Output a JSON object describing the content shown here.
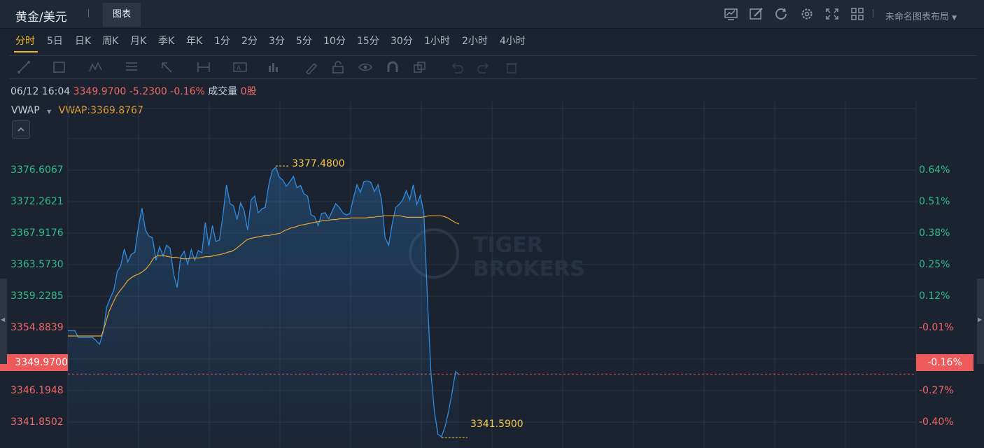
{
  "header": {
    "symbol": "黄金/美元",
    "chart_tab": "图表",
    "layout_label": "未命名图表布局"
  },
  "toolbar_icons": [
    "chart-icon",
    "edit-icon",
    "refresh-icon",
    "settings-icon",
    "fullscreen-icon",
    "layout-grid-icon"
  ],
  "periods": [
    "分时",
    "5日",
    "日K",
    "周K",
    "月K",
    "季K",
    "年K",
    "1分",
    "2分",
    "3分",
    "5分",
    "10分",
    "15分",
    "30分",
    "1小时",
    "2小时",
    "4小时"
  ],
  "active_period": "分时",
  "info": {
    "datetime": "06/12 16:04",
    "price": "3349.9700",
    "change": "-5.2300",
    "change_pct": "-0.16%",
    "volume_label": "成交量",
    "volume": "0股"
  },
  "indicator": {
    "name": "VWAP",
    "value": "VWAP:3369.8767"
  },
  "watermark": [
    "TIGER",
    "BROKERS"
  ],
  "colors": {
    "bg": "#1b2330",
    "line": "#2f8ce0",
    "vwap": "#e8a331",
    "up": "#2ebd85",
    "down": "#f06868",
    "extreme": "#f2c94c"
  },
  "chart_data": {
    "type": "line",
    "y_ticks_left": [
      "3376.6067",
      "3372.2621",
      "3367.9176",
      "3363.5730",
      "3359.2285",
      "3354.8839",
      "3346.1948",
      "3341.8502"
    ],
    "y_ticks_right": [
      "0.64%",
      "0.51%",
      "0.38%",
      "0.25%",
      "0.12%",
      "-0.01%",
      "-0.27%",
      "-0.40%"
    ],
    "current_price_label": "3349.9700",
    "current_pct_label": "-0.16%",
    "high_label": "3377.4800",
    "low_label": "3341.5900",
    "ylim": [
      3340.2,
      3386.0
    ],
    "high": 3377.48,
    "low": 3341.59,
    "current": 3349.97,
    "price_series": [
      3355.7,
      3355.7,
      3355.7,
      3354.8,
      3354.8,
      3354.8,
      3354.8,
      3354.8,
      3354.4,
      3353.9,
      3355.5,
      3358.8,
      3360.0,
      3361.0,
      3363.5,
      3364.3,
      3366.5,
      3364.8,
      3365.8,
      3366.1,
      3369.4,
      3371.9,
      3369.0,
      3368.2,
      3368.0,
      3365.0,
      3366.8,
      3365.6,
      3367.0,
      3366.6,
      3363.2,
      3361.4,
      3365.5,
      3366.2,
      3364.5,
      3366.4,
      3365.0,
      3366.3,
      3366.0,
      3370.0,
      3366.9,
      3369.6,
      3367.5,
      3367.7,
      3371.0,
      3375.0,
      3372.5,
      3372.2,
      3370.4,
      3372.6,
      3371.6,
      3369.0,
      3373.0,
      3373.5,
      3371.3,
      3371.8,
      3372.0,
      3375.0,
      3376.9,
      3377.3,
      3376.0,
      3375.6,
      3374.8,
      3375.4,
      3376.1,
      3374.6,
      3374.9,
      3373.8,
      3373.5,
      3371.0,
      3370.8,
      3369.6,
      3371.2,
      3371.3,
      3370.5,
      3371.5,
      3372.5,
      3372.0,
      3371.3,
      3371.0,
      3371.2,
      3373.2,
      3375.0,
      3374.0,
      3375.4,
      3375.5,
      3375.3,
      3374.1,
      3375.0,
      3373.0,
      3368.0,
      3367.0,
      3369.8,
      3372.0,
      3372.4,
      3373.0,
      3374.2,
      3373.0,
      3375.0,
      3372.4,
      3373.6,
      3371.3,
      3360.0,
      3350.2,
      3345.0,
      3342.0,
      3341.7,
      3343.0,
      3345.0,
      3347.5,
      3350.3,
      3349.9
    ],
    "vwap_series": [
      3355.0,
      3355.0,
      3355.0,
      3355.0,
      3355.0,
      3355.0,
      3355.0,
      3355.0,
      3355.0,
      3355.0,
      3356.5,
      3358.2,
      3359.3,
      3360.3,
      3361.0,
      3361.6,
      3362.3,
      3362.7,
      3363.0,
      3363.2,
      3363.5,
      3363.9,
      3364.5,
      3365.3,
      3365.6,
      3365.6,
      3365.6,
      3365.5,
      3365.4,
      3365.4,
      3365.3,
      3365.2,
      3365.2,
      3365.3,
      3365.3,
      3365.3,
      3365.4,
      3365.5,
      3365.5,
      3365.6,
      3365.7,
      3365.8,
      3365.9,
      3366.1,
      3366.2,
      3366.5,
      3366.9,
      3367.3,
      3367.7,
      3367.9,
      3368.0,
      3368.1,
      3368.2,
      3368.3,
      3368.3,
      3368.4,
      3368.5,
      3368.6,
      3368.9,
      3369.1,
      3369.3,
      3369.4,
      3369.6,
      3369.7,
      3369.8,
      3369.9,
      3370.0,
      3370.1,
      3370.2,
      3370.3,
      3370.3,
      3370.4,
      3370.4,
      3370.5,
      3370.5,
      3370.5,
      3370.6,
      3370.6,
      3370.6,
      3370.6,
      3370.6,
      3370.7,
      3370.7,
      3370.8,
      3370.8,
      3370.9,
      3370.9,
      3370.9,
      3370.9,
      3370.9,
      3370.8,
      3370.7,
      3370.7,
      3370.7,
      3370.7,
      3370.7,
      3370.8,
      3370.9,
      3370.9,
      3370.9,
      3370.9,
      3370.8,
      3370.6,
      3370.3,
      3370.0,
      3369.8
    ]
  }
}
